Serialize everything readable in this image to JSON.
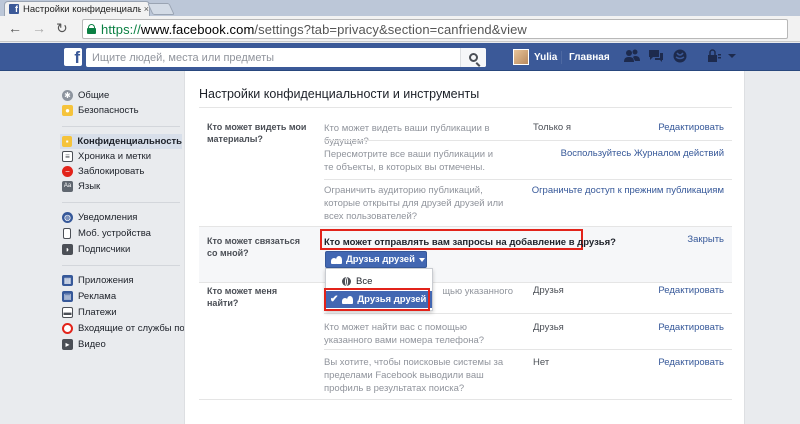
{
  "browser": {
    "tab_title": "Настройки конфиденциальности",
    "tab_close": "×",
    "url_scheme": "https://",
    "url_host": "www.facebook.com",
    "url_path": "/settings?tab=privacy&section=canfriend&view",
    "back_icon": "←",
    "forward_icon": "→",
    "reload_icon": "↻"
  },
  "topbar": {
    "logo": "f",
    "search_placeholder": "Ищите людей, места или предметы",
    "user_name": "Yulia",
    "home_label": "Главная",
    "icons": [
      "friend-requests-icon",
      "messages-icon",
      "notifications-icon",
      "privacy-shortcuts-icon",
      "menu-caret-icon"
    ]
  },
  "sidebar": {
    "items": [
      {
        "label": "Общие",
        "icon": "gear-icon",
        "color": "#8d949e"
      },
      {
        "label": "Безопасность",
        "icon": "badge-icon",
        "color": "#f5c33b"
      },
      {
        "label": "Конфиденциальность",
        "icon": "lock-icon",
        "color": "#f5c33b",
        "active": true
      },
      {
        "label": "Хроника и метки",
        "icon": "timeline-icon",
        "color": "#4b4f56"
      },
      {
        "label": "Заблокировать",
        "icon": "block-icon",
        "color": "#e2231a"
      },
      {
        "label": "Язык",
        "icon": "language-icon",
        "color": "#606770"
      },
      {
        "label": "Уведомления",
        "icon": "globe-icon",
        "color": "#365899"
      },
      {
        "label": "Моб. устройства",
        "icon": "mobile-icon",
        "color": "#4b4f56"
      },
      {
        "label": "Подписчики",
        "icon": "rss-icon",
        "color": "#4b4f56"
      },
      {
        "label": "Приложения",
        "icon": "apps-icon",
        "color": "#365899"
      },
      {
        "label": "Реклама",
        "icon": "ads-icon",
        "color": "#365899"
      },
      {
        "label": "Платежи",
        "icon": "payments-icon",
        "color": "#4b4f56"
      },
      {
        "label": "Входящие от службы по...",
        "icon": "support-inbox-icon",
        "color": "#e2231a"
      },
      {
        "label": "Видео",
        "icon": "video-icon",
        "color": "#4b4f56"
      }
    ]
  },
  "main": {
    "title": "Настройки конфиденциальности и инструменты",
    "sections": [
      {
        "heading": "Кто может видеть мои материалы?",
        "rows": [
          {
            "question": "Кто может видеть ваши публикации в будущем?",
            "value": "Только я",
            "action": "Редактировать"
          },
          {
            "question": "Пересмотрите все ваши публикации и те объекты, в которых вы отмечены.",
            "value": "",
            "action": "Воспользуйтесь Журналом действий"
          },
          {
            "question": "Ограничить аудиторию публикаций, которые открыты для друзей друзей или всех пользователей?",
            "value": "",
            "action": "Ограничьте доступ к прежним публикациям"
          }
        ]
      },
      {
        "heading": "Кто может связаться со мной?",
        "rows": [
          {
            "question": "Кто может отправлять вам запросы на добавление в друзья?",
            "action": "Закрыть"
          }
        ],
        "dropdown": {
          "selected": "Друзья друзей",
          "options": [
            {
              "label": "Все",
              "icon": "globe-icon"
            },
            {
              "label": "Друзья друзей",
              "icon": "friends-icon",
              "checked": true
            }
          ]
        }
      },
      {
        "heading": "Кто может меня найти?",
        "rows": [
          {
            "question": "Кто может найти вас с помощью указанного",
            "value": "Друзья",
            "action": "Редактировать"
          },
          {
            "question": "Кто может найти вас с помощью указанного вами номера телефона?",
            "value": "Друзья",
            "action": "Редактировать"
          },
          {
            "question": "Вы хотите, чтобы поисковые системы за пределами Facebook выводили ваш профиль в результатах поиска?",
            "value": "Нет",
            "action": "Редактировать"
          }
        ]
      }
    ]
  },
  "colors": {
    "facebook_blue": "#3b5998",
    "button_blue": "#4267b2",
    "highlight_red": "#e2231a",
    "link": "#365899"
  }
}
